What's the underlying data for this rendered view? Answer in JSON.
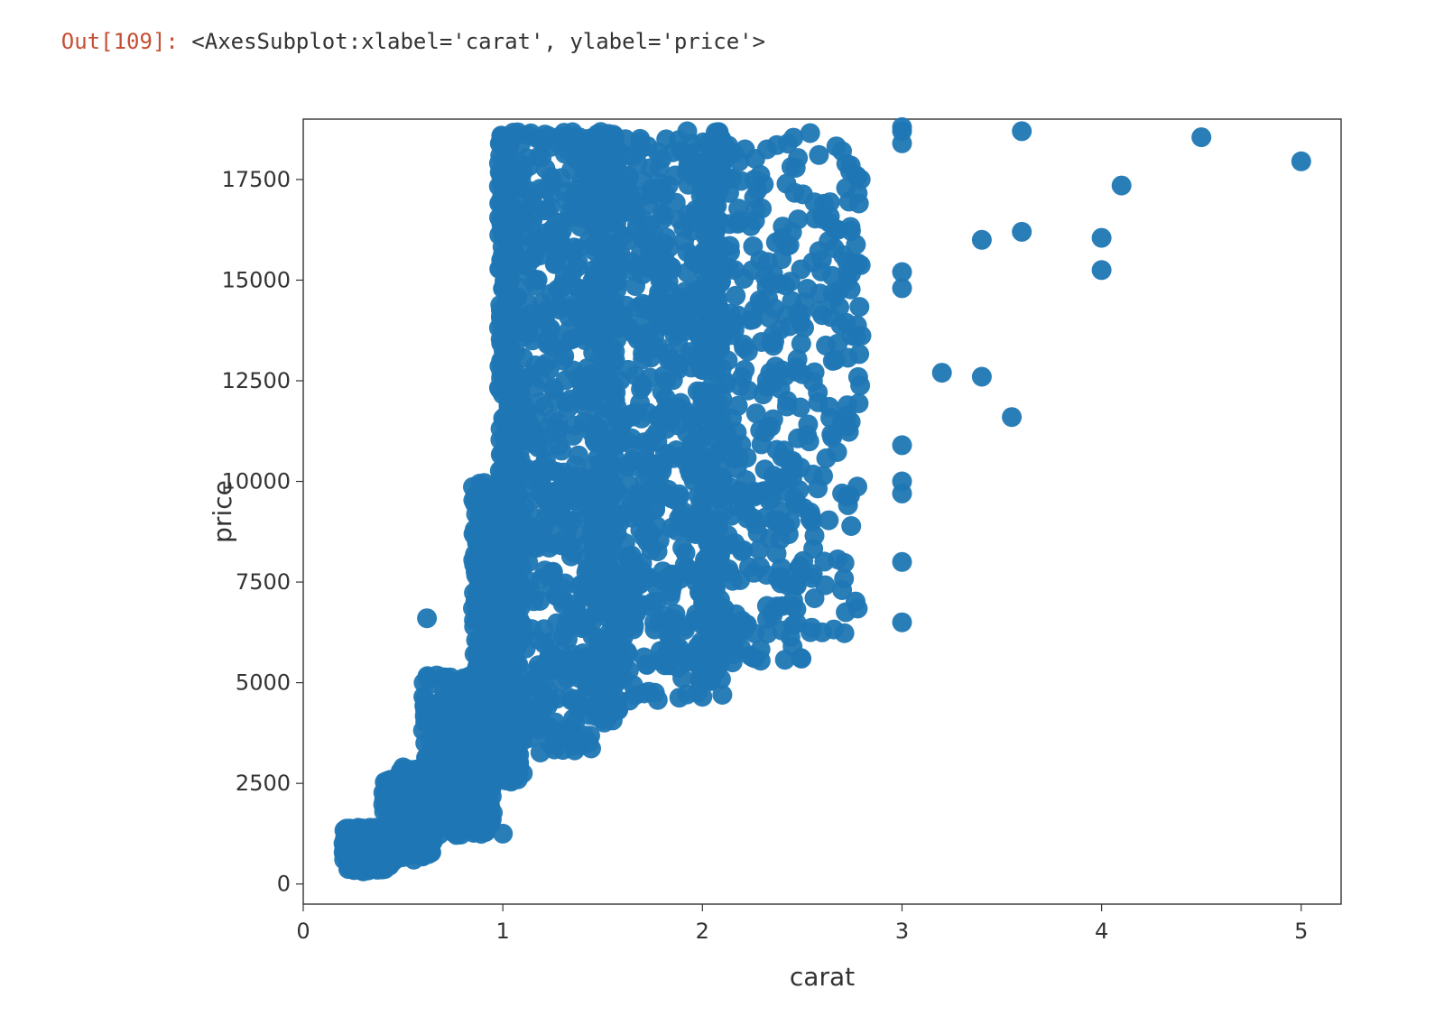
{
  "notebook": {
    "out_prompt": "Out[109]: ",
    "out_text": "<AxesSubplot:xlabel='carat', ylabel='price'>"
  },
  "chart_data": {
    "type": "scatter",
    "xlabel": "carat",
    "ylabel": "price",
    "xlim": [
      0,
      5.2
    ],
    "ylim": [
      -500,
      19000
    ],
    "xticks": [
      0,
      1,
      2,
      3,
      4,
      5
    ],
    "yticks": [
      0,
      2500,
      5000,
      7500,
      10000,
      12500,
      15000,
      17500
    ],
    "marker_color": "#1f77b4",
    "marker_radius": 11,
    "dense_clusters": [
      {
        "x_range": [
          0.2,
          0.45
        ],
        "y_range": [
          300,
          1400
        ],
        "n": 280
      },
      {
        "x_range": [
          0.4,
          0.65
        ],
        "y_range": [
          600,
          2600
        ],
        "n": 260
      },
      {
        "x_range": [
          0.48,
          0.58
        ],
        "y_range": [
          1200,
          2900
        ],
        "n": 180
      },
      {
        "x_range": [
          0.6,
          0.95
        ],
        "y_range": [
          1200,
          5200
        ],
        "n": 320
      },
      {
        "x_range": [
          0.68,
          0.75
        ],
        "y_range": [
          1600,
          4600
        ],
        "n": 220
      },
      {
        "x_range": [
          0.85,
          1.1
        ],
        "y_range": [
          2500,
          10000
        ],
        "n": 420
      },
      {
        "x_range": [
          0.98,
          1.05
        ],
        "y_range": [
          2500,
          18700
        ],
        "n": 360
      },
      {
        "x_range": [
          1.05,
          1.45
        ],
        "y_range": [
          3200,
          18700
        ],
        "n": 520
      },
      {
        "x_range": [
          1.45,
          1.58
        ],
        "y_range": [
          4000,
          18700
        ],
        "n": 360
      },
      {
        "x_range": [
          1.58,
          1.98
        ],
        "y_range": [
          4500,
          18700
        ],
        "n": 420
      },
      {
        "x_range": [
          1.98,
          2.1
        ],
        "y_range": [
          5000,
          18700
        ],
        "n": 340
      },
      {
        "x_range": [
          2.1,
          2.5
        ],
        "y_range": [
          5500,
          18700
        ],
        "n": 260
      },
      {
        "x_range": [
          2.5,
          2.8
        ],
        "y_range": [
          6200,
          18700
        ],
        "n": 120
      }
    ],
    "lines": [
      {
        "x_range": [
          0.5,
          1.1
        ],
        "y": 2750,
        "n": 28
      }
    ],
    "extra_points": [
      {
        "x": 0.62,
        "y": 6600
      },
      {
        "x": 0.95,
        "y": 9700
      },
      {
        "x": 1.0,
        "y": 1250
      },
      {
        "x": 2.0,
        "y": 4650
      },
      {
        "x": 2.1,
        "y": 4700
      },
      {
        "x": 2.45,
        "y": 6900
      },
      {
        "x": 2.6,
        "y": 6250
      },
      {
        "x": 2.55,
        "y": 9000
      },
      {
        "x": 2.55,
        "y": 7600
      },
      {
        "x": 2.7,
        "y": 7300
      },
      {
        "x": 2.7,
        "y": 9700
      },
      {
        "x": 2.7,
        "y": 11500
      },
      {
        "x": 3.0,
        "y": 6500
      },
      {
        "x": 3.0,
        "y": 8000
      },
      {
        "x": 3.0,
        "y": 9700
      },
      {
        "x": 3.0,
        "y": 10000
      },
      {
        "x": 3.0,
        "y": 10900
      },
      {
        "x": 3.0,
        "y": 14800
      },
      {
        "x": 3.0,
        "y": 15200
      },
      {
        "x": 3.0,
        "y": 18400
      },
      {
        "x": 3.0,
        "y": 18700
      },
      {
        "x": 3.0,
        "y": 18800
      },
      {
        "x": 3.2,
        "y": 12700
      },
      {
        "x": 3.4,
        "y": 12600
      },
      {
        "x": 3.4,
        "y": 16000
      },
      {
        "x": 3.55,
        "y": 11600
      },
      {
        "x": 3.6,
        "y": 16200
      },
      {
        "x": 3.6,
        "y": 18700
      },
      {
        "x": 4.0,
        "y": 15250
      },
      {
        "x": 4.0,
        "y": 16050
      },
      {
        "x": 4.1,
        "y": 17350
      },
      {
        "x": 4.5,
        "y": 18550
      },
      {
        "x": 5.0,
        "y": 17950
      }
    ]
  }
}
